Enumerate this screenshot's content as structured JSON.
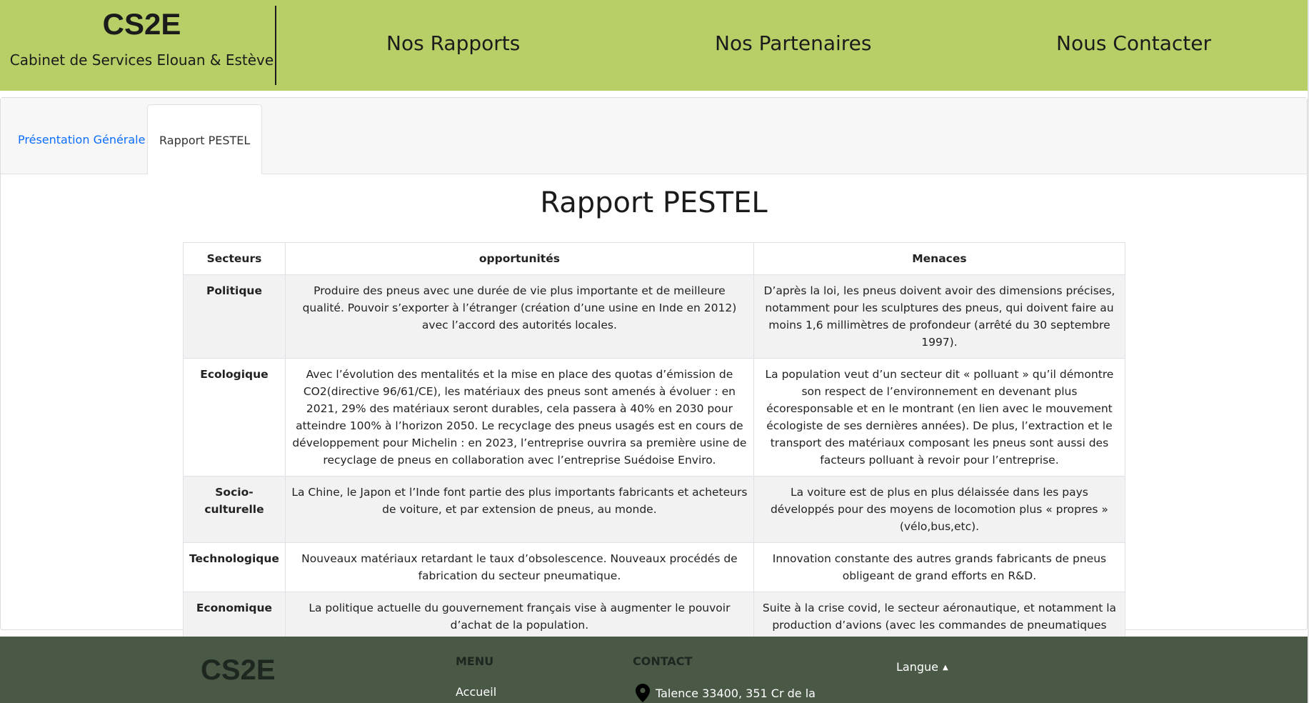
{
  "header": {
    "brand_title": "CS2E",
    "brand_subtitle": "Cabinet de Services Elouan & Estève",
    "nav": [
      "Nos Rapports",
      "Nos Partenaires",
      "Nous Contacter"
    ],
    "background": "#b7cf66"
  },
  "tabs": [
    {
      "label": "Présentation Générale",
      "active": false
    },
    {
      "label": "Rapport PESTEL",
      "active": true
    }
  ],
  "main": {
    "heading": "Rapport PESTEL",
    "table": {
      "headers": [
        "Secteurs",
        "opportunités",
        "Menaces"
      ],
      "rows": [
        {
          "sector": "Politique",
          "opportunity": "Produire des pneus avec une durée de vie plus importante et de meilleure qualité. Pouvoir s’exporter à l’étranger (création d’une usine en Inde en 2012) avec l’accord des autorités locales.",
          "threat": "D’après la loi, les pneus doivent avoir des dimensions précises, notamment pour les sculptures des pneus, qui doivent faire au moins 1,6 millimètres de profondeur (arrêté du 30 septembre 1997)."
        },
        {
          "sector": "Ecologique",
          "opportunity": "Avec l’évolution des mentalités et la mise en place des quotas d’émission de CO2(directive 96/61/CE), les matériaux des pneus sont amenés à évoluer : en 2021, 29% des matériaux seront durables, cela passera à 40% en 2030 pour atteindre 100% à l’horizon 2050. Le recyclage des pneus usagés est en cours de développement pour Michelin : en 2023, l’entreprise ouvrira sa première usine de recyclage de pneus en collaboration avec l’entreprise Suédoise Enviro.",
          "threat": "La population veut d’un secteur dit « polluant » qu’il démontre son respect de l’environnement en devenant plus écoresponsable et en le montrant (en lien avec le mouvement écologiste de ses dernières années). De plus, l’extraction et le transport des matériaux composant les pneus sont aussi des facteurs polluant à revoir pour l’entreprise."
        },
        {
          "sector": "Socio-culturelle",
          "opportunity": "La Chine, le Japon et l’Inde font partie des plus importants fabricants et acheteurs de voiture, et par extension de pneus, au monde.",
          "threat": "La voiture est de plus en plus délaissée dans les pays développés pour des moyens de locomotion plus « propres » (vélo,bus,etc)."
        },
        {
          "sector": "Technologique",
          "opportunity": "Nouveaux matériaux retardant le taux d’obsolescence. Nouveaux procédés de fabrication du secteur pneumatique.",
          "threat": "Innovation constante des autres grands fabricants de pneus obligeant de grand efforts en R&D."
        },
        {
          "sector": "Economique",
          "opportunity": "La politique actuelle du gouvernement français vise à augmenter le pouvoir d’achat de la population.",
          "threat": "Suite à la crise covid, le secteur aéronautique, et notamment la production d’avions (avec les commandes de pneumatiques pour avion), a connu un arrêt complet."
        }
      ]
    }
  },
  "footer": {
    "brand": "CS2E",
    "menu_heading": "MENU",
    "menu_link": "Accueil",
    "contact_heading": "CONTACT",
    "contact_address": "Talence 33400, 351 Cr de la",
    "language_label": "Langue",
    "background": "#4a5846"
  }
}
